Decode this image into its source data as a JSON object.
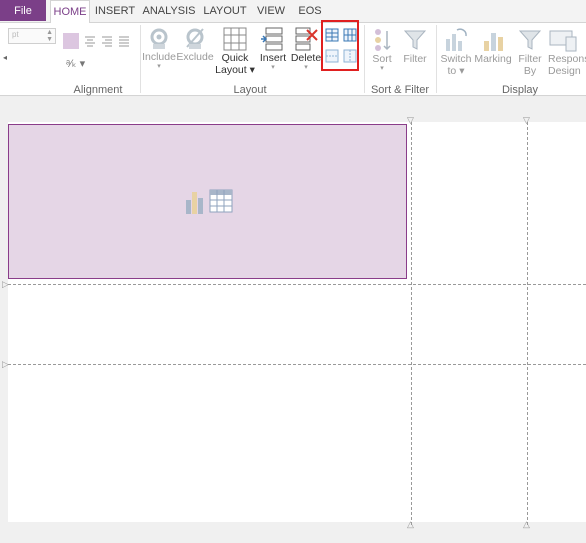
{
  "tabs": {
    "file": "File",
    "home": "HOME",
    "insert": "INSERT",
    "analysis": "ANALYSIS",
    "layout": "LAYOUT",
    "view": "VIEW",
    "eos": "EOS"
  },
  "ribbon": {
    "groups": {
      "alignment": "Alignment",
      "layout": "Layout",
      "sort_filter": "Sort & Filter",
      "display": "Display"
    },
    "buttons": {
      "include": "Include",
      "exclude": "Exclude",
      "quick_layout": [
        "Quick",
        "Layout"
      ],
      "insert": "Insert",
      "delete": "Delete",
      "sort": "Sort",
      "filter": "Filter",
      "switch_to": [
        "Switch",
        "to"
      ],
      "marking": "Marking",
      "filter_by": [
        "Filter",
        "By"
      ],
      "responsive_design": [
        "Respons",
        "Design"
      ]
    },
    "mini_input_text": "pt"
  },
  "colors": {
    "accent": "#7b3f88",
    "cell_fill": "#e5d6e6",
    "highlight": "#e02020"
  }
}
